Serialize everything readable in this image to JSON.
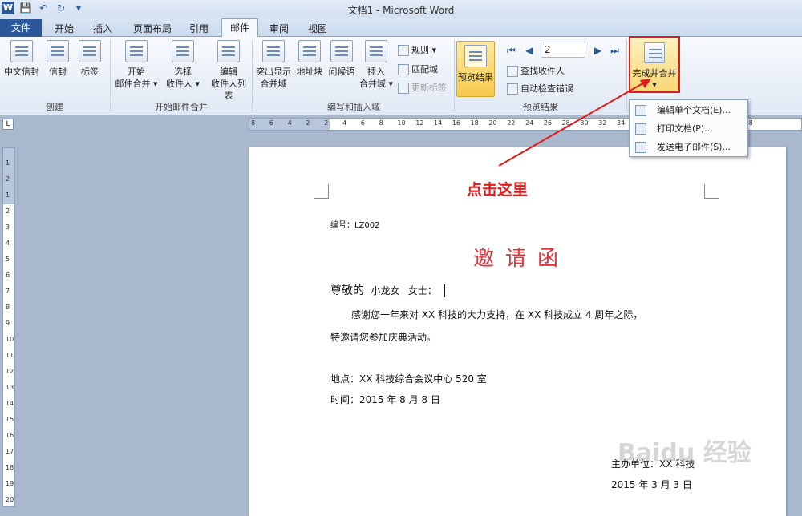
{
  "window": {
    "title": "文档1 - Microsoft Word"
  },
  "quick_access": {
    "icons": [
      "word-icon",
      "save-icon",
      "undo-icon",
      "redo-icon",
      "customize-icon"
    ]
  },
  "tabs": [
    {
      "label": "文件",
      "active": false
    },
    {
      "label": "开始",
      "active": false
    },
    {
      "label": "插入",
      "active": false
    },
    {
      "label": "页面布局",
      "active": false
    },
    {
      "label": "引用",
      "active": false
    },
    {
      "label": "邮件",
      "active": true
    },
    {
      "label": "审阅",
      "active": false
    },
    {
      "label": "视图",
      "active": false
    }
  ],
  "ribbon": {
    "create": {
      "label": "创建",
      "chinese_envelope": "中文信封",
      "envelope": "信封",
      "labels": "标签"
    },
    "start_merge": {
      "label": "开始邮件合并",
      "start_line1": "开始",
      "start_line2": "邮件合并 ▾",
      "select_line1": "选择",
      "select_line2": "收件人 ▾",
      "edit_line1": "编辑",
      "edit_line2": "收件人列表"
    },
    "write_insert": {
      "label": "编写和插入域",
      "highlight_line1": "突出显示",
      "highlight_line2": "合并域",
      "address_block": "地址块",
      "greeting_line": "问候语",
      "insert_line1": "插入",
      "insert_line2": "合并域 ▾",
      "rules": "规则 ▾",
      "match_fields": "匹配域",
      "update_labels": "更新标签"
    },
    "preview": {
      "label": "预览结果",
      "preview_results": "预览结果",
      "record_number": "2",
      "find_recipient": "查找收件人",
      "auto_check": "自动检查错误"
    },
    "finish": {
      "finish_merge": "完成并合并",
      "dropdown_arrow": "▾"
    }
  },
  "finish_menu": [
    {
      "label": "编辑单个文档(E)...",
      "icon": "edit-document-icon"
    },
    {
      "label": "打印文档(P)...",
      "icon": "print-icon"
    },
    {
      "label": "发送电子邮件(S)...",
      "icon": "email-icon"
    }
  ],
  "annotation": "点击这里",
  "document": {
    "number": "编号：LZ002",
    "title": "邀请函",
    "salutation_prefix": "尊敬的",
    "recipient": "小龙女",
    "title_suffix": "女士：",
    "body_line1": "感谢您一年来对 XX 科技的大力支持，在 XX 科技成立 4 周年之际，",
    "body_line2": "特邀请您参加庆典活动。",
    "location": "地点：XX 科技综合会议中心 520 室",
    "time": "时间：2015 年 8 月 8 日",
    "organizer": "主办单位：XX 科技",
    "date": "2015 年 3 月 3 日"
  },
  "ruler_ticks": [
    "8",
    "6",
    "4",
    "2",
    "2",
    "4",
    "6",
    "8",
    "10",
    "12",
    "14",
    "16",
    "18",
    "20",
    "22",
    "24",
    "26",
    "28",
    "30",
    "32",
    "34",
    "36",
    "38",
    "40",
    "42",
    "44",
    "46",
    "48"
  ],
  "vruler_ticks": [
    "1",
    "2",
    "1",
    "2",
    "3",
    "4",
    "5",
    "6",
    "7",
    "8",
    "9",
    "10",
    "11",
    "12",
    "13",
    "14",
    "15",
    "16",
    "17",
    "18",
    "19",
    "20"
  ],
  "watermark": "Baidu 经验"
}
